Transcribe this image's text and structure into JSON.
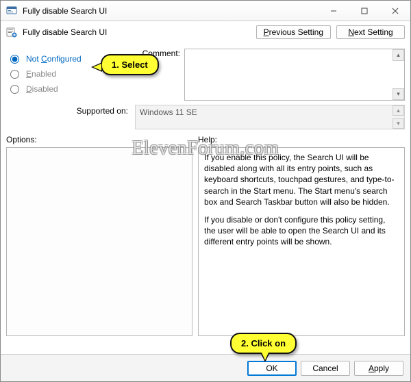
{
  "window": {
    "title": "Fully disable Search UI"
  },
  "header": {
    "policy_title": "Fully disable Search UI",
    "prev_prefix": "P",
    "prev_rest": "revious Setting",
    "next_prefix": "N",
    "next_rest": "ext Setting"
  },
  "radios": {
    "not_configured_prefix": "C",
    "not_configured_label": "Not ",
    "not_configured_rest": "onfigured",
    "enabled_prefix": "E",
    "enabled_rest": "nabled",
    "disabled_prefix": "D",
    "disabled_rest": "isabled",
    "selected": "not_configured"
  },
  "comment": {
    "label": "Comment:"
  },
  "supported": {
    "label": "Supported on:",
    "value": "Windows 11 SE"
  },
  "labels": {
    "options": "Options:",
    "help": "Help:"
  },
  "help": {
    "p1": "If you enable this policy, the Search UI will be disabled along with all its entry points, such as keyboard shortcuts, touchpad gestures, and type-to-search in the Start menu. The Start menu's search box and Search Taskbar button will also be hidden.",
    "p2": "If you disable or don't configure this policy setting, the user will be able to open the Search UI and its different entry points will be shown."
  },
  "footer": {
    "ok": "OK",
    "cancel": "Cancel",
    "apply_prefix": "A",
    "apply_rest": "pply"
  },
  "callouts": {
    "c1": "1. Select",
    "c2": "2. Click on"
  },
  "watermark": "ElevenForum.com"
}
